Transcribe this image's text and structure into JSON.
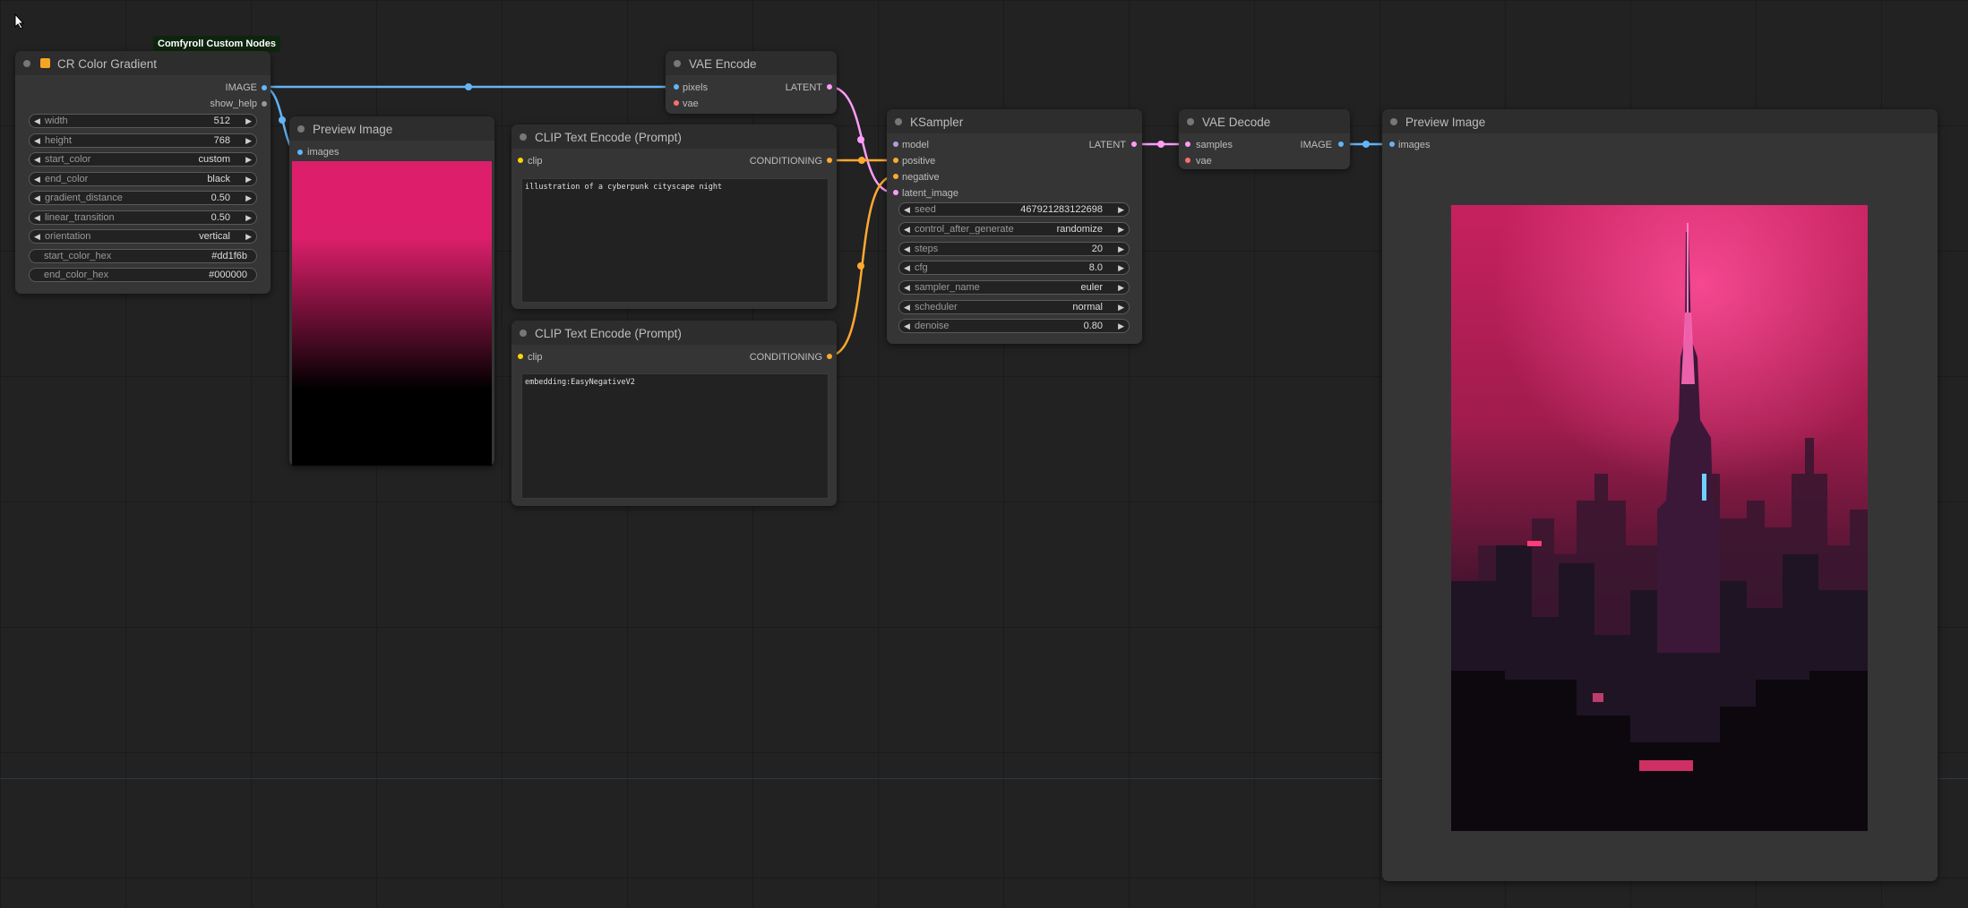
{
  "colors": {
    "image_link": "#64b5f6",
    "latent_link": "#ff9cf9",
    "conditioning_link": "#ffa931",
    "vae_port": "#ff6e6e",
    "model_port": "#b39ddb",
    "clip_port": "#ffd500",
    "gradient_start": "#dd1f6b",
    "gradient_end": "#000000",
    "badge_bg": "#0e250d"
  },
  "nodes": {
    "cr_color_gradient": {
      "badge": "Comfyroll Custom Nodes",
      "title": "CR Color Gradient",
      "outputs": {
        "image": "IMAGE",
        "show_help": "show_help"
      },
      "widgets": [
        {
          "label": "width",
          "value": "512"
        },
        {
          "label": "height",
          "value": "768"
        },
        {
          "label": "start_color",
          "value": "custom"
        },
        {
          "label": "end_color",
          "value": "black"
        },
        {
          "label": "gradient_distance",
          "value": "0.50"
        },
        {
          "label": "linear_transition",
          "value": "0.50"
        },
        {
          "label": "orientation",
          "value": "vertical"
        }
      ],
      "text_widgets": [
        {
          "label": "start_color_hex",
          "value": "#dd1f6b"
        },
        {
          "label": "end_color_hex",
          "value": "#000000"
        }
      ]
    },
    "preview_image_small": {
      "title": "Preview Image",
      "inputs": {
        "images": "images"
      }
    },
    "vae_encode": {
      "title": "VAE Encode",
      "inputs": {
        "pixels": "pixels",
        "vae": "vae"
      },
      "outputs": {
        "latent": "LATENT"
      }
    },
    "clip_positive": {
      "title": "CLIP Text Encode (Prompt)",
      "inputs": {
        "clip": "clip"
      },
      "outputs": {
        "conditioning": "CONDITIONING"
      },
      "text": "illustration of a cyberpunk cityscape night"
    },
    "clip_negative": {
      "title": "CLIP Text Encode (Prompt)",
      "inputs": {
        "clip": "clip"
      },
      "outputs": {
        "conditioning": "CONDITIONING"
      },
      "text": "embedding:EasyNegativeV2"
    },
    "ksampler": {
      "title": "KSampler",
      "inputs": {
        "model": "model",
        "positive": "positive",
        "negative": "negative",
        "latent_image": "latent_image"
      },
      "outputs": {
        "latent": "LATENT"
      },
      "widgets": [
        {
          "label": "seed",
          "value": "467921283122698"
        },
        {
          "label": "control_after_generate",
          "value": "randomize"
        },
        {
          "label": "steps",
          "value": "20"
        },
        {
          "label": "cfg",
          "value": "8.0"
        },
        {
          "label": "sampler_name",
          "value": "euler"
        },
        {
          "label": "scheduler",
          "value": "normal"
        },
        {
          "label": "denoise",
          "value": "0.80"
        }
      ]
    },
    "vae_decode": {
      "title": "VAE Decode",
      "inputs": {
        "samples": "samples",
        "vae": "vae"
      },
      "outputs": {
        "image": "IMAGE"
      }
    },
    "preview_image_large": {
      "title": "Preview Image",
      "inputs": {
        "images": "images"
      }
    }
  }
}
